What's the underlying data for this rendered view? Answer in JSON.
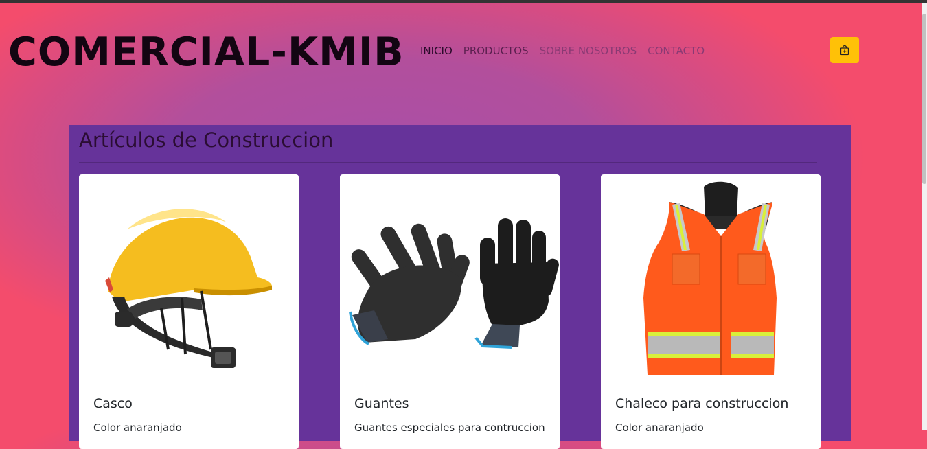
{
  "brand": "COMERCIAL-KMIB",
  "nav": {
    "items": [
      {
        "label": "INICIO"
      },
      {
        "label": "PRODUCTOS"
      },
      {
        "label": "SOBRE NOSOTROS"
      },
      {
        "label": "CONTACTO"
      }
    ]
  },
  "cart": {
    "icon": "shopping-bag-icon",
    "color": "#ffc107"
  },
  "section": {
    "title": "Artículos de Construccion"
  },
  "products": [
    {
      "name": "Casco",
      "description": "Color anaranjado",
      "image": "hard-hat"
    },
    {
      "name": "Guantes",
      "description": "Guantes especiales para contruccion",
      "image": "gloves"
    },
    {
      "name": "Chaleco para construccion",
      "description": "Color anaranjado",
      "image": "safety-vest"
    }
  ],
  "colors": {
    "panel": "#66339a",
    "card": "#ffffff",
    "accent": "#ffc107"
  }
}
